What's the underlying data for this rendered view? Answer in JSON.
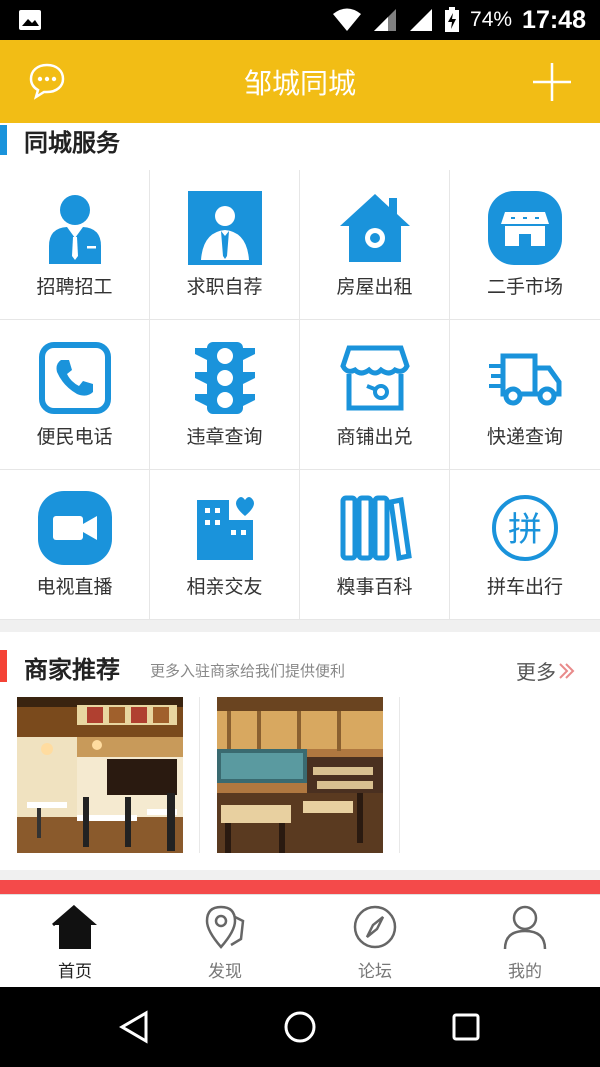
{
  "status_bar": {
    "battery_pct": "74%",
    "time": "17:48"
  },
  "app_bar": {
    "title": "邹城同城"
  },
  "services": {
    "heading": "同城服务",
    "items": [
      {
        "label": "招聘招工",
        "icon": "worker-icon"
      },
      {
        "label": "求职自荐",
        "icon": "job-seeker-icon"
      },
      {
        "label": "房屋出租",
        "icon": "house-icon"
      },
      {
        "label": "二手市场",
        "icon": "shop-icon"
      },
      {
        "label": "便民电话",
        "icon": "phone-icon"
      },
      {
        "label": "违章查询",
        "icon": "traffic-light-icon"
      },
      {
        "label": "商铺出兑",
        "icon": "store-icon"
      },
      {
        "label": "快递查询",
        "icon": "truck-icon"
      },
      {
        "label": "电视直播",
        "icon": "video-icon"
      },
      {
        "label": "相亲交友",
        "icon": "building-heart-icon"
      },
      {
        "label": "糗事百科",
        "icon": "books-icon"
      },
      {
        "label": "拼车出行",
        "icon": "carpool-icon"
      }
    ],
    "icon_color": "#1a93db"
  },
  "merchants": {
    "heading": "商家推荐",
    "subtitle": "更多入驻商家给我们提供便利",
    "more_label": "更多",
    "items": [
      {
        "name": "restaurant-photo-1"
      },
      {
        "name": "restaurant-photo-2"
      }
    ]
  },
  "tabbar": {
    "tabs": [
      {
        "label": "首页",
        "icon": "home-icon",
        "active": true
      },
      {
        "label": "发现",
        "icon": "discover-icon",
        "active": false
      },
      {
        "label": "论坛",
        "icon": "compass-icon",
        "active": false
      },
      {
        "label": "我的",
        "icon": "profile-icon",
        "active": false
      }
    ]
  },
  "colors": {
    "brand": "#f2bd15",
    "accent_blue": "#1a93db",
    "accent_red": "#f44336"
  }
}
